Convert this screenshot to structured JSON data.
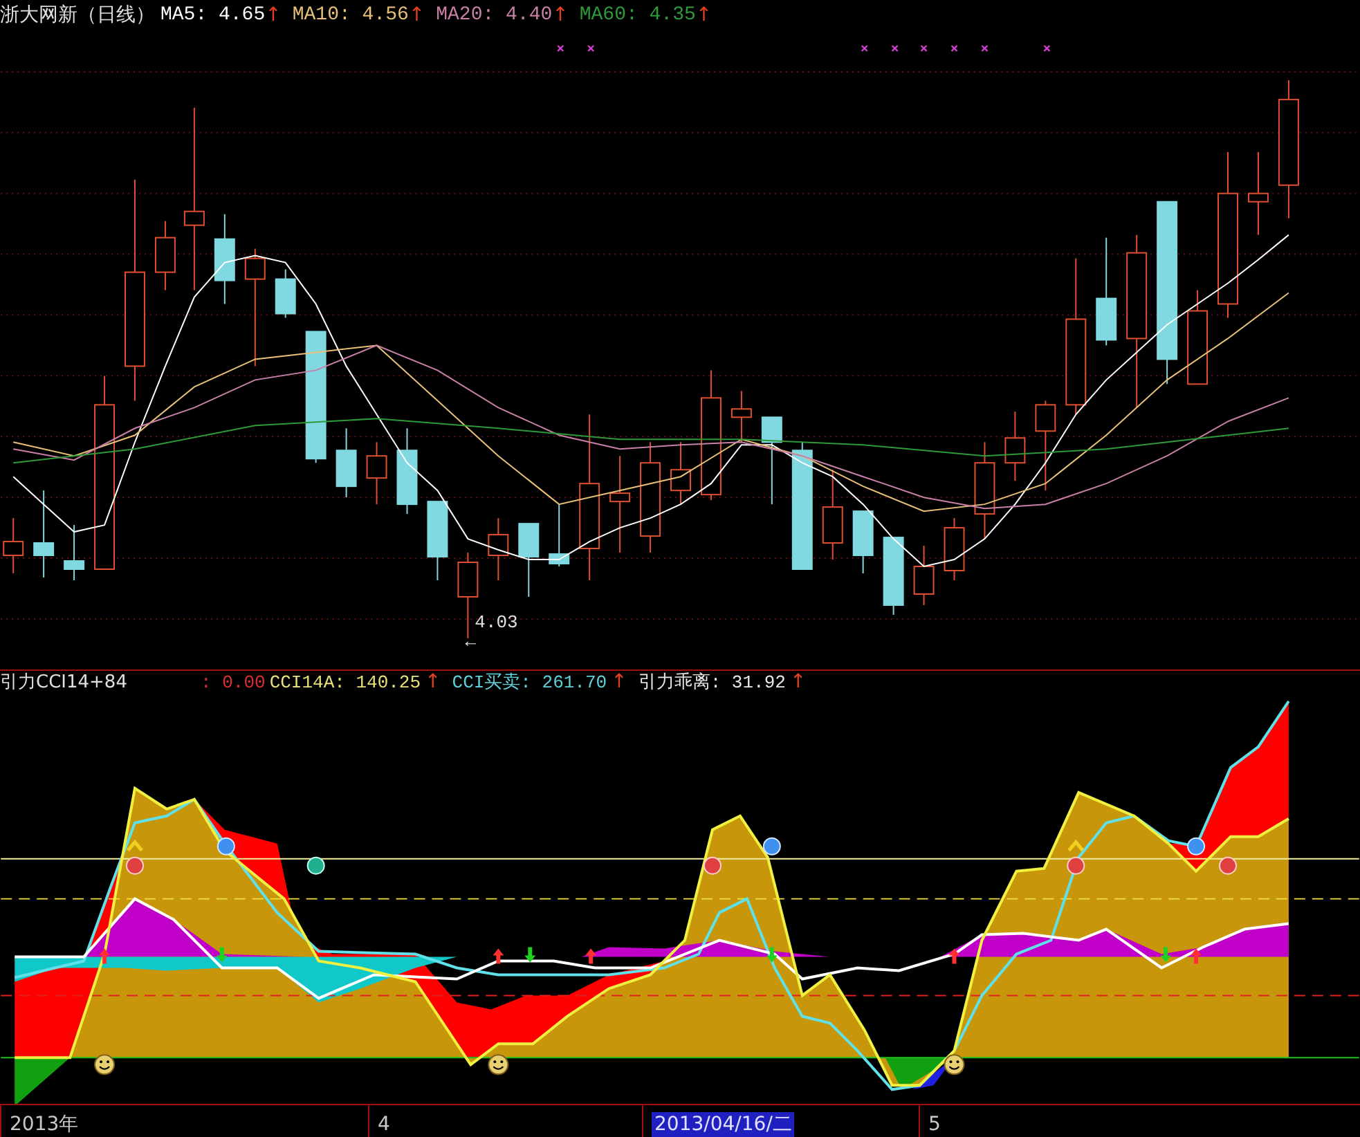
{
  "chart_header": {
    "title": "浙大网新（日线）",
    "ma": [
      {
        "text": "MA5: 4.65",
        "arrow": "↑",
        "color": "#ffffff"
      },
      {
        "text": "MA10: 4.56",
        "arrow": "↑",
        "color": "#e8c078"
      },
      {
        "text": "MA20: 4.40",
        "arrow": "↑",
        "color": "#c880a8"
      },
      {
        "text": "MA60: 4.35",
        "arrow": "↑",
        "color": "#2e9a3a"
      }
    ]
  },
  "price_marker": {
    "value": "4.03",
    "arrow": "←"
  },
  "indicator_header": {
    "title": "引力CCI14+84",
    "items": [
      {
        "text": ": 0.00",
        "color": "#d83030"
      },
      {
        "text": "CCI14A: 140.25",
        "arrow": "↑",
        "color": "#e8e078"
      },
      {
        "text": "CCI买卖: 261.70",
        "arrow": "↑",
        "color": "#60d0d8"
      },
      {
        "text": "引力乖离: 31.92",
        "arrow": "↑",
        "color": "#e8e8e8"
      }
    ]
  },
  "time_axis": [
    {
      "label": "2013年",
      "selected": false
    },
    {
      "label": "4",
      "selected": false
    },
    {
      "label": "2013/04/16/二",
      "selected": true
    },
    {
      "label": "5",
      "selected": false
    }
  ]
}
